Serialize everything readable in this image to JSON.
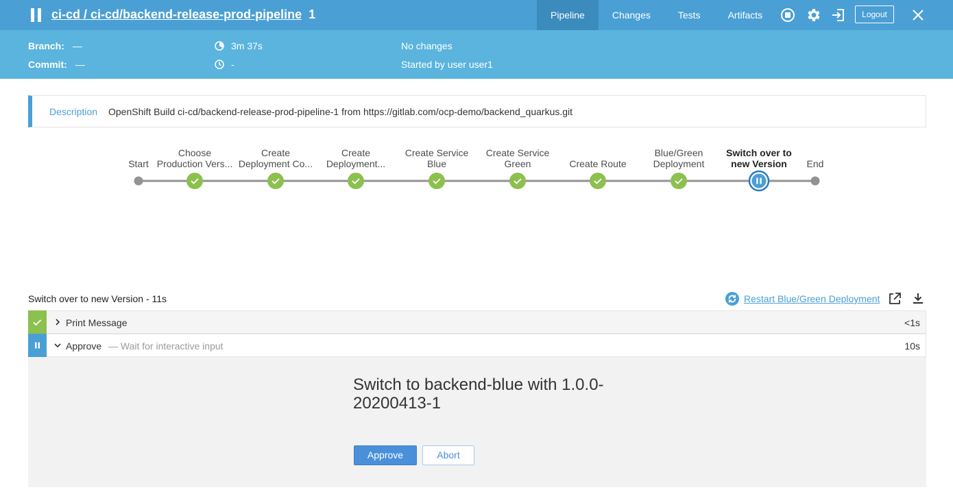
{
  "header": {
    "pipeline_path": "ci-cd / ci-cd/backend-release-prod-pipeline",
    "run_number": "1",
    "tabs": [
      {
        "label": "Pipeline",
        "active": true
      },
      {
        "label": "Changes",
        "active": false
      },
      {
        "label": "Tests",
        "active": false
      },
      {
        "label": "Artifacts",
        "active": false
      }
    ],
    "icons": [
      "stop-icon",
      "gear-icon",
      "exit-icon",
      "close-icon"
    ],
    "logout_label": "Logout"
  },
  "subheader": {
    "branch_label": "Branch:",
    "branch_value": "—",
    "commit_label": "Commit:",
    "commit_value": "—",
    "duration": "3m 37s",
    "time": "-",
    "changes": "No changes",
    "started_by": "Started by user user1"
  },
  "description": {
    "label": "Description",
    "text": "OpenShift Build ci-cd/backend-release-prod-pipeline-1 from https://gitlab.com/ocp-demo/backend_quarkus.git"
  },
  "stages": [
    {
      "line1": "",
      "line2": "Start",
      "status": "start"
    },
    {
      "line1": "Choose",
      "line2": "Production Vers...",
      "status": "success"
    },
    {
      "line1": "Create",
      "line2": "Deployment Co...",
      "status": "success"
    },
    {
      "line1": "Create",
      "line2": "Deployment...",
      "status": "success"
    },
    {
      "line1": "Create Service",
      "line2": "Blue",
      "status": "success"
    },
    {
      "line1": "Create Service",
      "line2": "Green",
      "status": "success"
    },
    {
      "line1": "",
      "line2": "Create Route",
      "status": "success"
    },
    {
      "line1": "Blue/Green",
      "line2": "Deployment",
      "status": "success"
    },
    {
      "line1": "Switch over to",
      "line2": "new Version",
      "status": "paused"
    },
    {
      "line1": "",
      "line2": "End",
      "status": "end"
    }
  ],
  "steps": {
    "title": "Switch over to new Version - 11s",
    "restart_label": "Restart Blue/Green Deployment",
    "rows": [
      {
        "name": "Print Message",
        "sub": "",
        "duration": "<1s",
        "status": "success",
        "expanded": false
      },
      {
        "name": "Approve",
        "sub": "— Wait for interactive input",
        "duration": "10s",
        "status": "paused",
        "expanded": true
      }
    ]
  },
  "input": {
    "message": "Switch to backend-blue with 1.0.0-20200413-1",
    "approve_label": "Approve",
    "abort_label": "Abort"
  },
  "colors": {
    "header": "#4a9fd5",
    "subheader": "#5ab4dd",
    "success": "#8cc04f",
    "paused": "#4a9fd5",
    "node_gray": "#949393"
  }
}
